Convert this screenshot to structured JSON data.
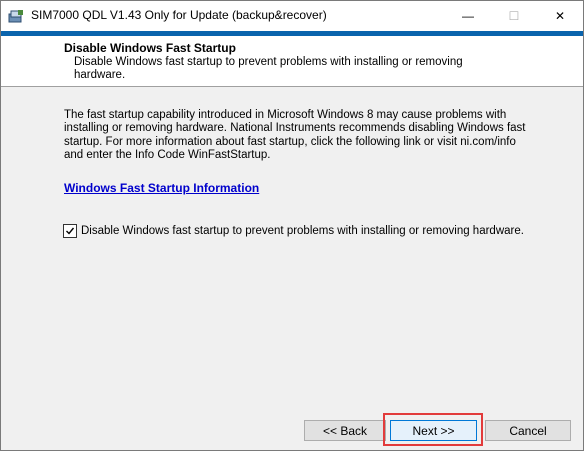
{
  "window": {
    "title": "SIM7000 QDL V1.43 Only for Update (backup&recover)",
    "controls": {
      "minimize": "—",
      "maximize": "☐",
      "close": "✕"
    }
  },
  "header": {
    "title": "Disable Windows Fast Startup",
    "subtitle": "Disable Windows fast startup to prevent problems with installing or removing hardware."
  },
  "body": {
    "description": "The fast startup capability introduced in Microsoft Windows 8 may cause problems with installing or removing hardware. National Instruments recommends disabling Windows fast startup. For more information about fast startup, click the following link or visit ni.com/info and enter the Info Code WinFastStartup.",
    "link_label": "Windows Fast Startup Information",
    "checkbox_label": "Disable Windows fast startup to prevent problems with installing or removing hardware.",
    "checkbox_checked": true
  },
  "buttons": {
    "back": "<< Back",
    "next": "Next >>",
    "cancel": "Cancel"
  },
  "colors": {
    "accent": "#0a64ad",
    "highlight": "#e23b3b",
    "link": "#0000cc"
  }
}
